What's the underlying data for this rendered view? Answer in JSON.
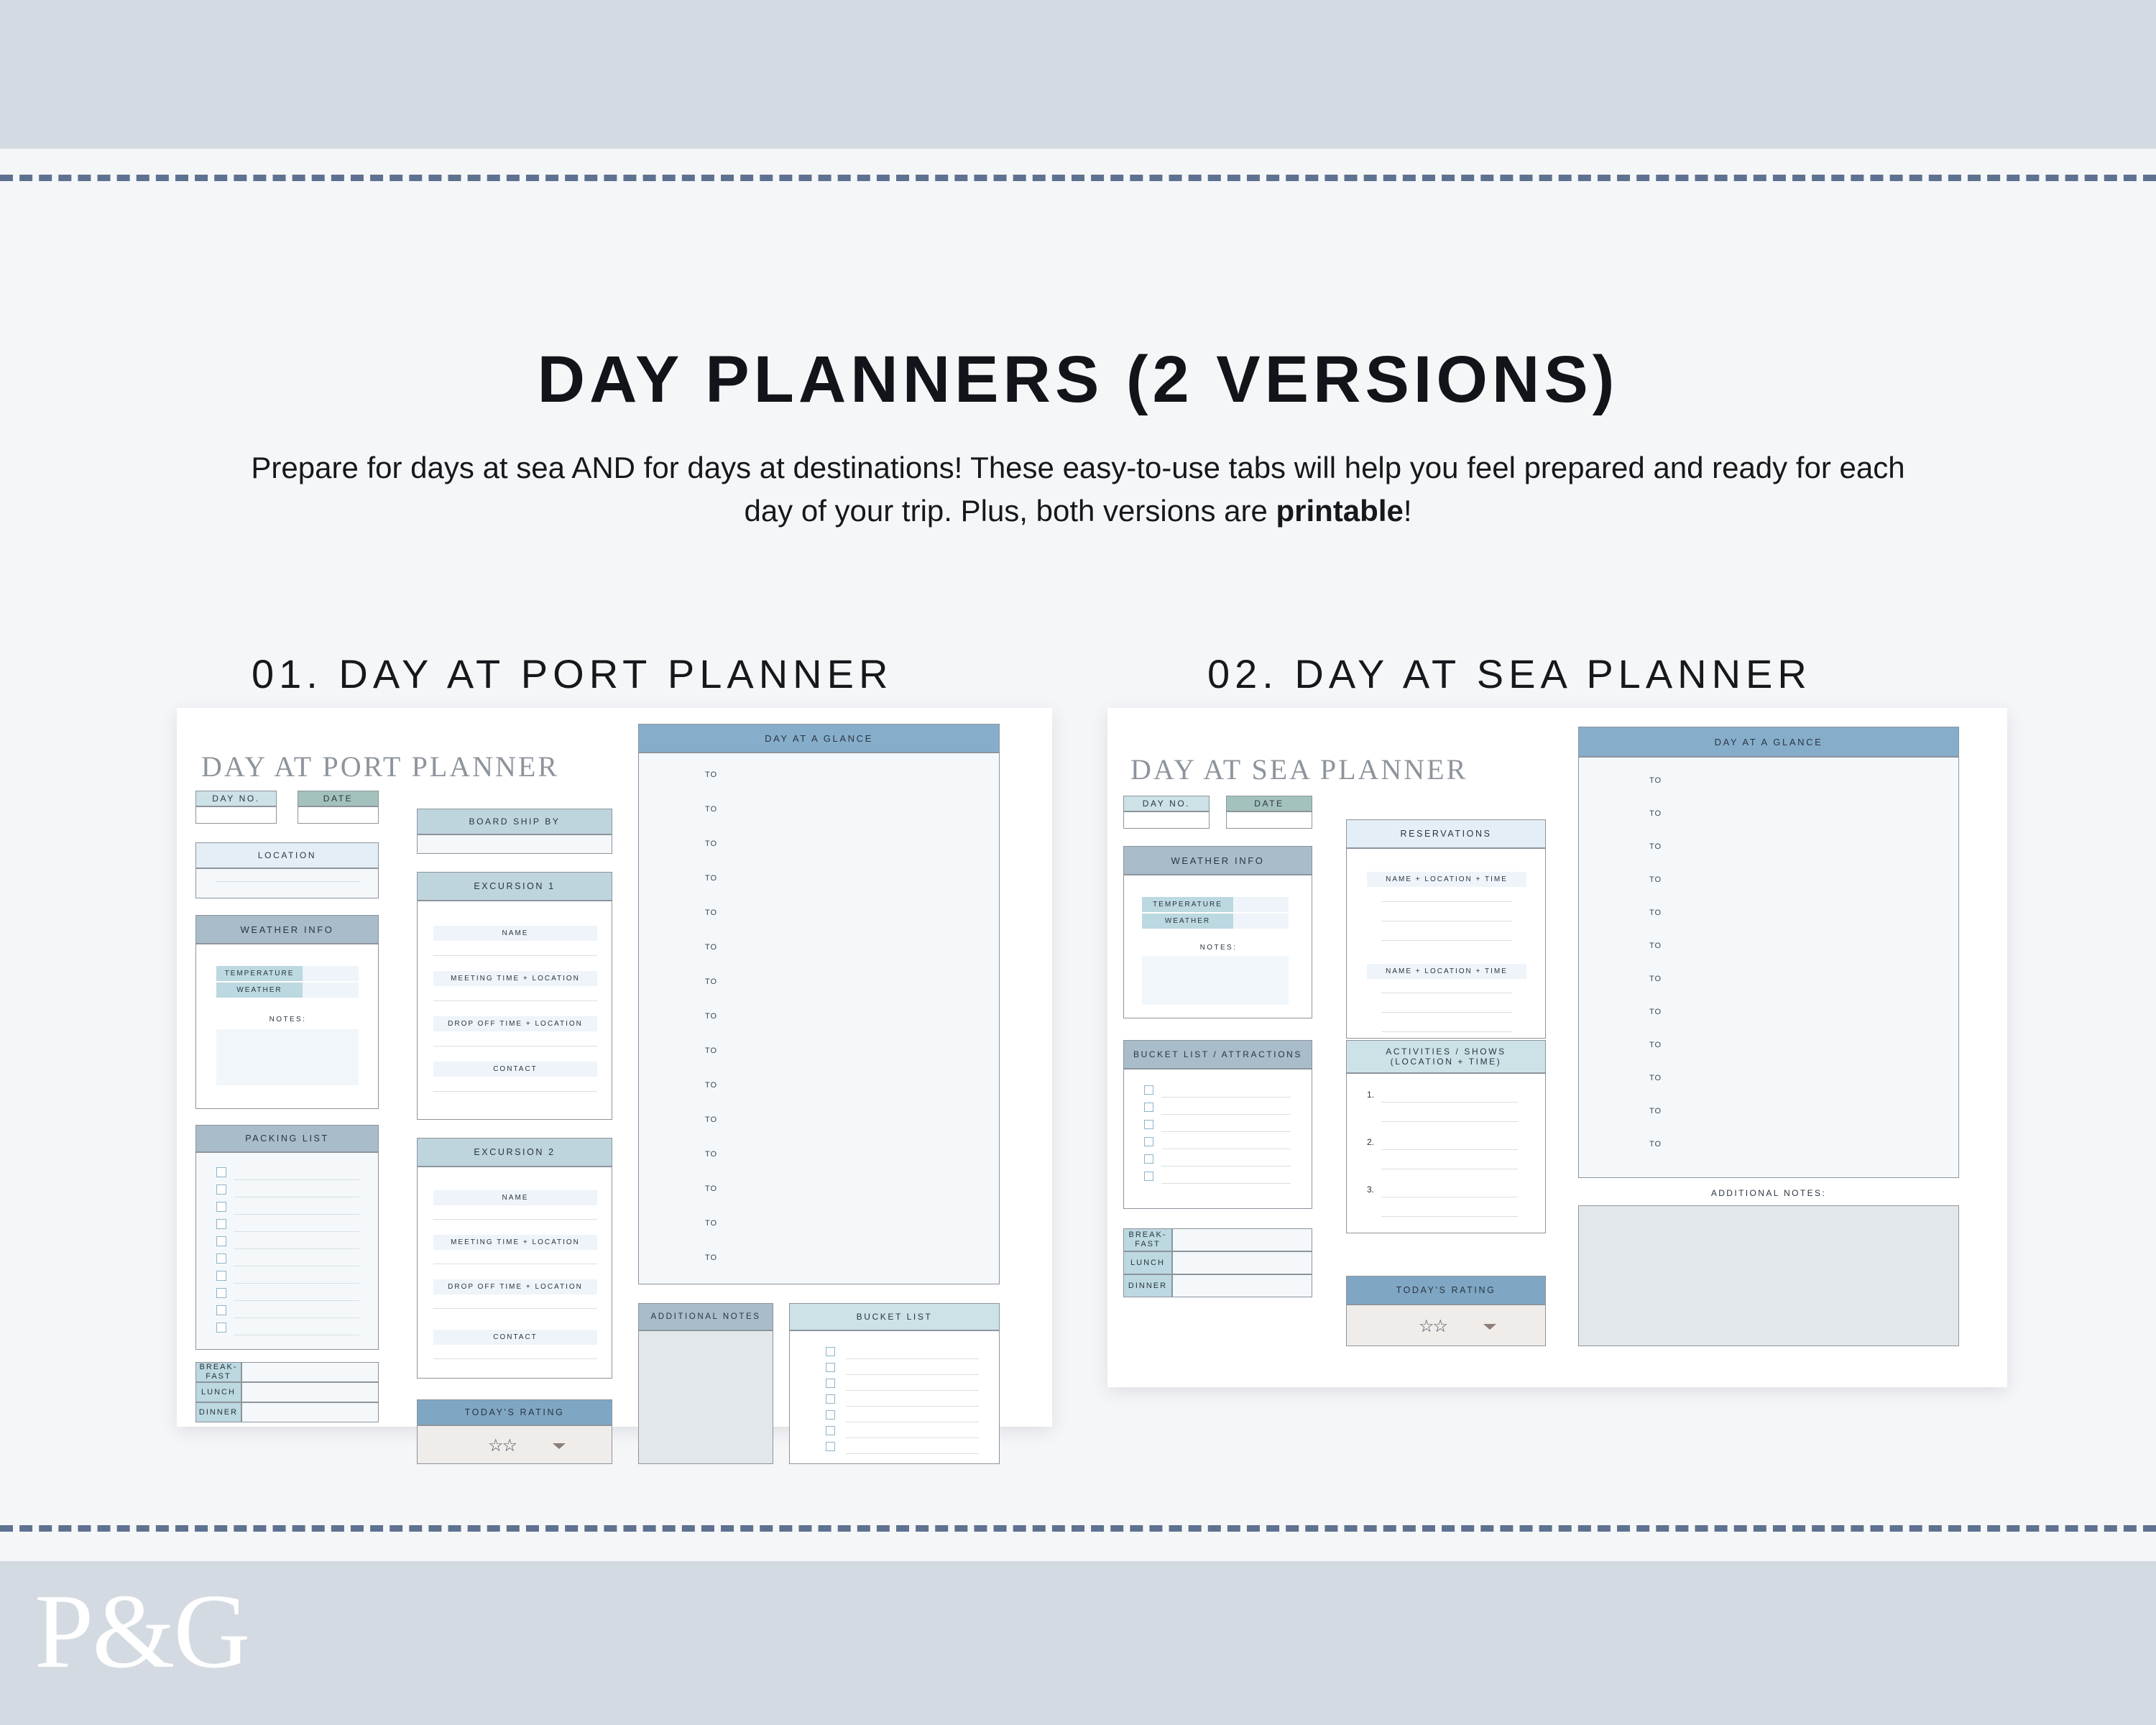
{
  "page": {
    "title": "DAY PLANNERS (2 VERSIONS)",
    "subtitle_part1": "Prepare for days at sea AND for days at destinations! These easy-to-use tabs will help you feel prepared and ready for each day of your trip. Plus, both versions are ",
    "subtitle_bold": "printable",
    "subtitle_part2": "!",
    "logo": "P&G",
    "accent_colors": {
      "band": "#d4dae2",
      "dash": "#5f7190",
      "header_blue": "#86aecb",
      "header_steel": "#a9bcca",
      "header_mid": "#bed5de",
      "header_sage": "#a4c2bd",
      "header_pale": "#e4eef6",
      "body_pale": "#f4f8fb",
      "body_grey": "#e2e7eb",
      "body_cream": "#efecea"
    }
  },
  "sections": [
    {
      "label": "01. DAY AT PORT PLANNER"
    },
    {
      "label": "02. DAY AT SEA PLANNER"
    }
  ],
  "port_planner": {
    "title": "DAY AT PORT PLANNER",
    "day_no_label": "DAY NO.",
    "date_label": "DATE",
    "location_label": "LOCATION",
    "weather_info_label": "WEATHER INFO",
    "temperature_label": "TEMPERATURE",
    "weather_label": "WEATHER",
    "notes_label": "NOTES:",
    "packing_list_label": "PACKING LIST",
    "packing_list_rows": 10,
    "meals": [
      {
        "label": "BREAK-\nFAST"
      },
      {
        "label": "LUNCH"
      },
      {
        "label": "DINNER"
      }
    ],
    "board_ship_by_label": "BOARD SHIP BY",
    "excursions": [
      {
        "title": "EXCURSION 1",
        "fields": [
          "NAME",
          "MEETING TIME + LOCATION",
          "DROP OFF TIME + LOCATION",
          "CONTACT"
        ]
      },
      {
        "title": "EXCURSION 2",
        "fields": [
          "NAME",
          "MEETING TIME + LOCATION",
          "DROP OFF TIME + LOCATION",
          "CONTACT"
        ]
      }
    ],
    "todays_rating_label": "TODAY'S RATING",
    "rating_stars": "☆☆",
    "day_at_a_glance_label": "DAY AT A GLANCE",
    "glance_rows": 15,
    "glance_row_label": "TO",
    "additional_notes_label": "ADDITIONAL NOTES",
    "bucket_list_label": "BUCKET LIST",
    "bucket_list_rows": 7
  },
  "sea_planner": {
    "title": "DAY AT SEA PLANNER",
    "day_no_label": "DAY NO.",
    "date_label": "DATE",
    "weather_info_label": "WEATHER INFO",
    "temperature_label": "TEMPERATURE",
    "weather_label": "WEATHER",
    "notes_label": "NOTES:",
    "bucket_list_label": "BUCKET LIST / ATTRACTIONS",
    "bucket_list_rows": 6,
    "meals": [
      {
        "label": "BREAK-\nFAST"
      },
      {
        "label": "LUNCH"
      },
      {
        "label": "DINNER"
      }
    ],
    "reservations_label": "RESERVATIONS",
    "reservation_fields": [
      "NAME + LOCATION + TIME",
      "NAME + LOCATION + TIME"
    ],
    "activities_label_line1": "ACTIVITIES / SHOWS",
    "activities_label_line2": "(LOCATION + TIME)",
    "activity_numbers": [
      "1.",
      "2.",
      "3."
    ],
    "todays_rating_label": "TODAY'S RATING",
    "rating_stars": "☆☆",
    "day_at_a_glance_label": "DAY AT A GLANCE",
    "glance_rows": 12,
    "glance_row_label": "TO",
    "additional_notes_label": "ADDITIONAL NOTES:"
  }
}
